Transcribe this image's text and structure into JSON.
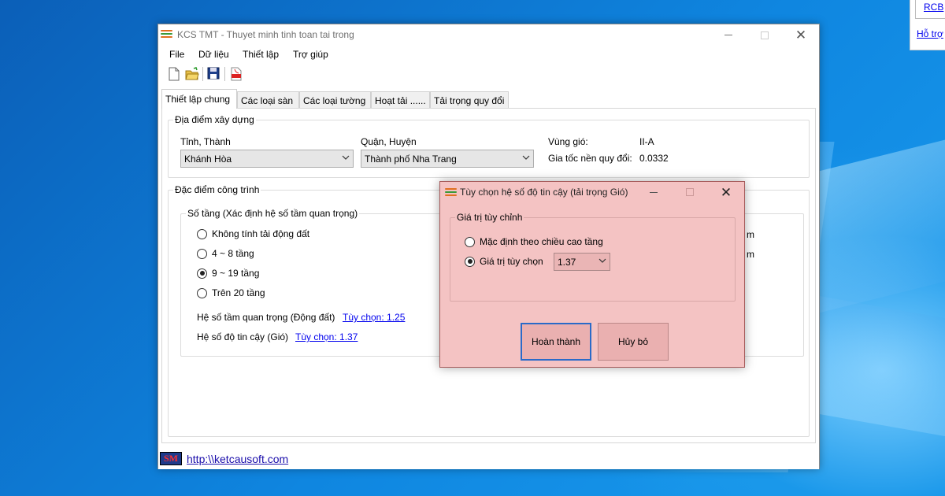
{
  "background_window": {
    "link1": "RCB",
    "link2": "Hỗ trợ"
  },
  "app": {
    "title": "KCS TMT - Thuyet minh tinh toan tai trong",
    "menu": [
      "File",
      "Dữ liệu",
      "Thiết lập",
      "Trợ giúp"
    ],
    "toolbar_icons": [
      "new-file-icon",
      "open-folder-icon",
      "save-icon",
      "pdf-icon"
    ],
    "tabs": [
      "Thiết lập chung",
      "Các loại sàn",
      "Các loại tường",
      "Hoạt tải ......",
      "Tải trọng quy đổi"
    ],
    "active_tab": "Thiết lập chung"
  },
  "location": {
    "group_title": "Địa điểm xây dựng",
    "province_label": "Tỉnh, Thành",
    "province_value": "Khánh Hòa",
    "district_label": "Quận, Huyện",
    "district_value": "Thành phố Nha Trang",
    "wind_zone_label": "Vùng gió:",
    "wind_zone_value": "II-A",
    "accel_label": "Gia tốc nền quy đổi:",
    "accel_value": "0.0332"
  },
  "building": {
    "group_title": "Đặc điểm công trình",
    "floors_group_title": "Số tầng (Xác định hệ số tầm quan trọng)",
    "options": [
      "Không tính tải động đất",
      "4 ~ 8 tầng",
      "9 ~ 19 tầng",
      "Trên 20 tầng"
    ],
    "selected_index": 2,
    "importance_label": "Hệ số tầm quan trọng (Động đất)",
    "importance_link": "Tùy chọn: 1.25",
    "reliability_label": "Hệ số độ tin cậy (Gió)",
    "reliability_link": "Tùy chọn: 1.37",
    "clipped_right_1": "m",
    "clipped_right_2": "m"
  },
  "statusbar": {
    "logo_text": "SM",
    "website": "http:\\\\ketcausoft.com"
  },
  "dialog": {
    "title": "Tùy chọn hệ số độ tin cậy (tải trọng Gió)",
    "group_title": "Giá trị tùy chỉnh",
    "option_default": "Mặc định theo chiều cao tầng",
    "option_custom": "Giá trị tùy chọn",
    "custom_value": "1.37",
    "ok_button": "Hoàn thành",
    "cancel_button": "Hủy bỏ"
  },
  "colors": {
    "dialog_bg": "#f4c3c3",
    "link": "#0000ee",
    "desktop": "#0a78d4"
  }
}
